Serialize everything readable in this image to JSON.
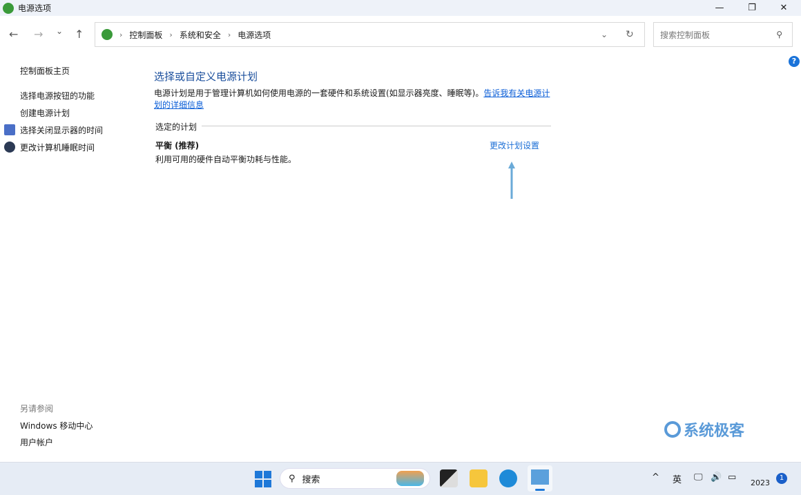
{
  "window": {
    "title": "电源选项",
    "min": "—",
    "max": "❐",
    "close": "✕"
  },
  "nav": {
    "back": "←",
    "forward": "→",
    "recent": "⌄",
    "up": "↑",
    "refresh": "↻",
    "dropdown": "⌄"
  },
  "breadcrumb": [
    "控制面板",
    "系统和安全",
    "电源选项"
  ],
  "search": {
    "placeholder": "搜索控制面板",
    "icon": "search-icon"
  },
  "help": "?",
  "sidebar": {
    "home": "控制面板主页",
    "items": [
      "选择电源按钮的功能",
      "创建电源计划",
      "选择关闭显示器的时间",
      "更改计算机睡眠时间"
    ],
    "see_also": "另请参阅",
    "links": [
      "Windows 移动中心",
      "用户帐户"
    ]
  },
  "main": {
    "title": "选择或自定义电源计划",
    "description": "电源计划是用于管理计算机如何使用电源的一套硬件和系统设置(如显示器亮度、睡眠等)。",
    "learn_more": "告诉我有关电源计划的详细信息",
    "selected_header": "选定的计划",
    "plan_name": "平衡 (推荐)",
    "plan_desc": "利用可用的硬件自动平衡功耗与性能。",
    "change_link": "更改计划设置"
  },
  "watermark": "系统极客",
  "taskbar": {
    "search": "搜索",
    "ime": "英",
    "clock": "2023",
    "notifications": "1",
    "chevron": "^"
  }
}
